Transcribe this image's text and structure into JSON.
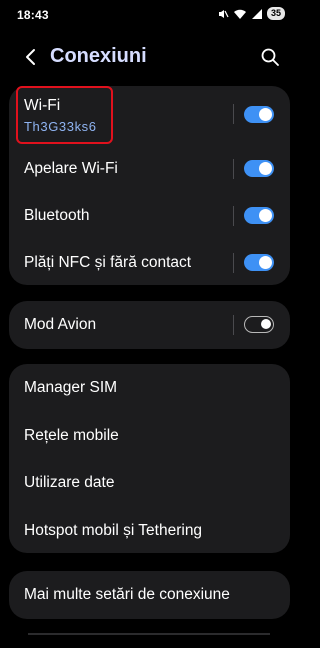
{
  "status_bar": {
    "time": "18:43",
    "battery": "35"
  },
  "header": {
    "title": "Conexiuni"
  },
  "group1": {
    "wifi": {
      "label": "Wi-Fi",
      "network": "Th3G33ks6",
      "on": true
    },
    "wifi_calling": {
      "label": "Apelare Wi-Fi",
      "on": true
    },
    "bluetooth": {
      "label": "Bluetooth",
      "on": true
    },
    "nfc": {
      "label": "Plăți NFC și fără contact",
      "on": true
    }
  },
  "group2": {
    "airplane": {
      "label": "Mod Avion",
      "on": false
    }
  },
  "group3": {
    "items": [
      {
        "label": "Manager SIM"
      },
      {
        "label": "Rețele mobile"
      },
      {
        "label": "Utilizare date"
      },
      {
        "label": "Hotspot mobil și Tethering"
      }
    ]
  },
  "group4": {
    "more": {
      "label": "Mai multe setări de conexiune"
    }
  },
  "colors": {
    "accent": "#3e91f5",
    "title": "#d6ddff",
    "card": "#1c1c1e",
    "highlight": "#e0111d"
  }
}
